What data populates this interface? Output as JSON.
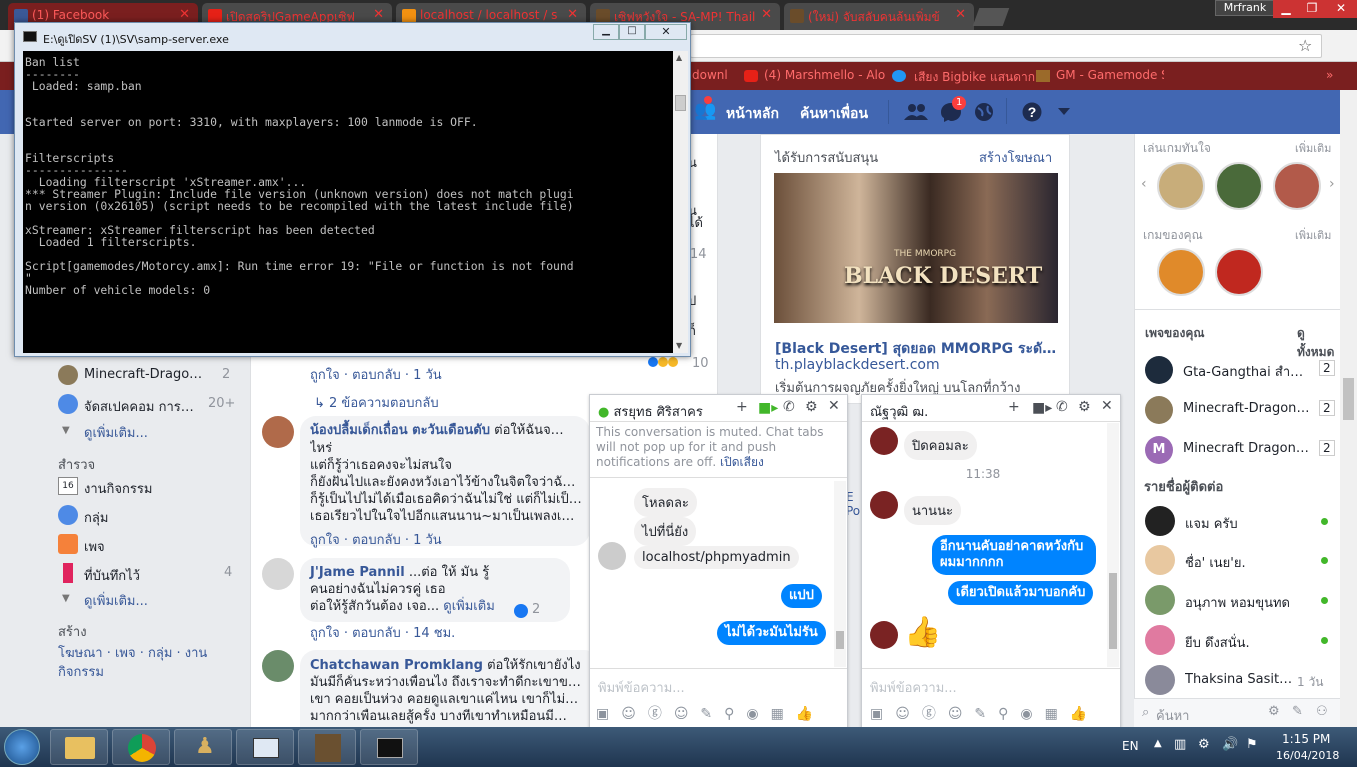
{
  "browser": {
    "tabs": [
      {
        "label": "(1) Facebook",
        "active": true
      },
      {
        "label": "เปิดสคริปGameAppเซิฟ",
        "active": false
      },
      {
        "label": "localhost / localhost / s",
        "active": false
      },
      {
        "label": "เซิฟหวังใจ - SA-MP! Thail",
        "active": false
      },
      {
        "label": "(ใหม่) จับสลับคนล้นเพิ่มข้",
        "active": false
      }
    ],
    "profile": "Mrfrank",
    "bookmarks": [
      "downl",
      "(4) Marshmello - Alo",
      "เสียง Bigbike แสนดาก",
      "GM - Gamemode Sc"
    ],
    "bookmarks_more": "»"
  },
  "fb_nav": {
    "home": "หน้าหลัก",
    "find_friends": "ค้นหาเพื่อน",
    "messages_badge": "1"
  },
  "left_nav": {
    "groups": [
      {
        "label": "Minecraft-Drago…",
        "count": "2"
      },
      {
        "label": "จัดสเปคคอม การ…",
        "count": "20+"
      }
    ],
    "see_more_1": "ดูเพิ่มเติม...",
    "explore_title": "สำรวจ",
    "explore": [
      {
        "label": "งานกิจกรรม",
        "count": "",
        "icon": "calendar-icon"
      },
      {
        "label": "กลุ่ม",
        "count": "",
        "icon": "group-icon"
      },
      {
        "label": "เพจ",
        "count": "",
        "icon": "flag-icon"
      },
      {
        "label": "ที่บันทึกไว้",
        "count": "4",
        "icon": "bookmark-icon"
      }
    ],
    "see_more_2": "ดูเพิ่มเติม...",
    "create_title": "สร้าง",
    "create_links": "โฆษณา · เพจ · กลุ่ม · งาน",
    "create_links2": "กิจกรรม"
  },
  "feed": {
    "actions1": "ถูกใจ · ตอบกลับ · 1 วัน",
    "replies": "2 ข้อความตอบกลับ",
    "comments": [
      {
        "author": "น้องปลื้มเด็กเถื่อน ตะวันเดือนดับ",
        "text": "ต่อให้ฉันจ…",
        "lines": [
          "ไหร่",
          "แต่ก็รู้ว่าเธอคงจะไม่สนใจ",
          "ก็ยังฝันไปและยังคงหวังเอาไว้ข้างในจิตใจว่าฉั…",
          "ก็รู้เป็นไปไม่ได้เมื่อเธอคิดว่าฉันไม่ใช่ แต่ก็ไม่เป็…",
          "เธอเรียวไปในใจไปอีกแสนนาน~มาเป็นเพลงเ…"
        ],
        "actions": "ถูกใจ · ตอบกลับ · 1 วัน"
      },
      {
        "author": "J'Jame Pannil",
        "text": "...ต่อ ให้ มัน รู้",
        "lines": [
          "คนอย่างฉันไม่ควรคู่ เธอ",
          "ต่อให้รู้สักวันต้อง เจอ..."
        ],
        "see_more": "ดูเพิ่มเติม",
        "likes": "2",
        "actions": "ถูกใจ · ตอบกลับ · 14 ชม."
      },
      {
        "author": "Chatchawan Promklang",
        "text": "ต่อให้รักเขายังไง",
        "lines": [
          "มันมีก็คั่นระหว่างเพื่อนไง ถึงเราจะทำดีกะเขาข…",
          "เขา คอยเป็นห่วง คอยดูแลเขาแค่ไหน เขาก็ไม่…",
          "มากกว่าเพื่อนเลยสู้ครั้ง บางทีเขาทำเหมือนมี…"
        ]
      }
    ],
    "partial_counts": [
      "14",
      "10"
    ],
    "partial_texts": [
      "น",
      "ได้",
      "ป",
      "ก็"
    ]
  },
  "ads": {
    "title": "ได้รับการสนับสนุน",
    "create": "สร้างโฆษณา",
    "image_text": "BLACK DESERT",
    "image_sub": "THE MMORPG",
    "headline": "[Black Desert] สุดยอด MMORPG ระดับ…",
    "url": "th.playblackdesert.com",
    "desc": "เริ่มต้นการผจญภัยครั้งยิ่งใหญ่ บนโลกที่กว้าง"
  },
  "right_sidebar": {
    "games_title": "เล่นเกมทันใจ",
    "see_more": "เพิ่มเติม",
    "your_games_title": "เกมของคุณ",
    "pages_title": "เพจของคุณ",
    "see_all": "ดูทั้งหมด",
    "pages": [
      {
        "label": "Gta-Gangthai สำห…",
        "count": "2"
      },
      {
        "label": "Minecraft-Dragon …",
        "count": "2"
      },
      {
        "label": "Minecraft Dragon …",
        "count": "2"
      }
    ],
    "contacts_title": "รายชื่อผู้ติดต่อ",
    "contacts": [
      {
        "name": "แจม ครับ",
        "status": "online"
      },
      {
        "name": "ชื่อ' เนย'ย.",
        "status": "online"
      },
      {
        "name": "อนุภาพ หอมขุนทด",
        "status": "online"
      },
      {
        "name": "ยีบ ดึงสนั่น.",
        "status": "online"
      },
      {
        "name": "Thaksina Sasit…",
        "status": "1 วัน"
      }
    ],
    "search_placeholder": "ค้นหา"
  },
  "terminal": {
    "title": "E:\\ดูเปิดSV (1)\\SV\\samp-server.exe",
    "lines": [
      "Ban list",
      "--------",
      " Loaded: samp.ban",
      "",
      "",
      "Started server on port: 3310, with maxplayers: 100 lanmode is OFF.",
      "",
      "",
      "Filterscripts",
      "---------------",
      "  Loading filterscript 'xStreamer.amx'...",
      "*** Streamer Plugin: Include file version (unknown version) does not match plugi",
      "n version (0x26105) (script needs to be recompiled with the latest include file)",
      "",
      "xStreamer: xStreamer filterscript has been detected",
      "  Loaded 1 filterscripts.",
      "",
      "Script[gamemodes/Motorcy.amx]: Run time error 19: \"File or function is not found",
      "\"",
      "Number of vehicle models: 0"
    ]
  },
  "chat1": {
    "name": "สรยุทธ ศิริสาคร",
    "muted_notice": "This conversation is muted. Chat tabs will not pop up for it and push notifications are off.",
    "unmute": "เปิดเสียง",
    "messages_in": [
      "โหลดละ",
      "ไปที่นี่ยัง",
      "localhost/phpmyadmin"
    ],
    "messages_out": [
      "แปป",
      "ไม่ได้วะมันไม่รัน"
    ],
    "input_placeholder": "พิมพ์ข้อความ..."
  },
  "chat2": {
    "name": "ณัฐวุฒิ ฒ.",
    "messages": [
      {
        "from": "in",
        "text": "ปิดคอมละ"
      },
      {
        "from": "time",
        "text": "11:38"
      },
      {
        "from": "in",
        "text": "นานนะ"
      },
      {
        "from": "out",
        "text": "อีกนานคับอย่าคาดหวังกับผมมากกกก"
      },
      {
        "from": "out",
        "text": "เดียวเปิดแล้วมาบอกคับ"
      }
    ],
    "input_placeholder": "พิมพ์ข้อความ..."
  },
  "taskbar": {
    "lang": "EN",
    "time": "1:15 PM",
    "date": "16/04/2018"
  }
}
